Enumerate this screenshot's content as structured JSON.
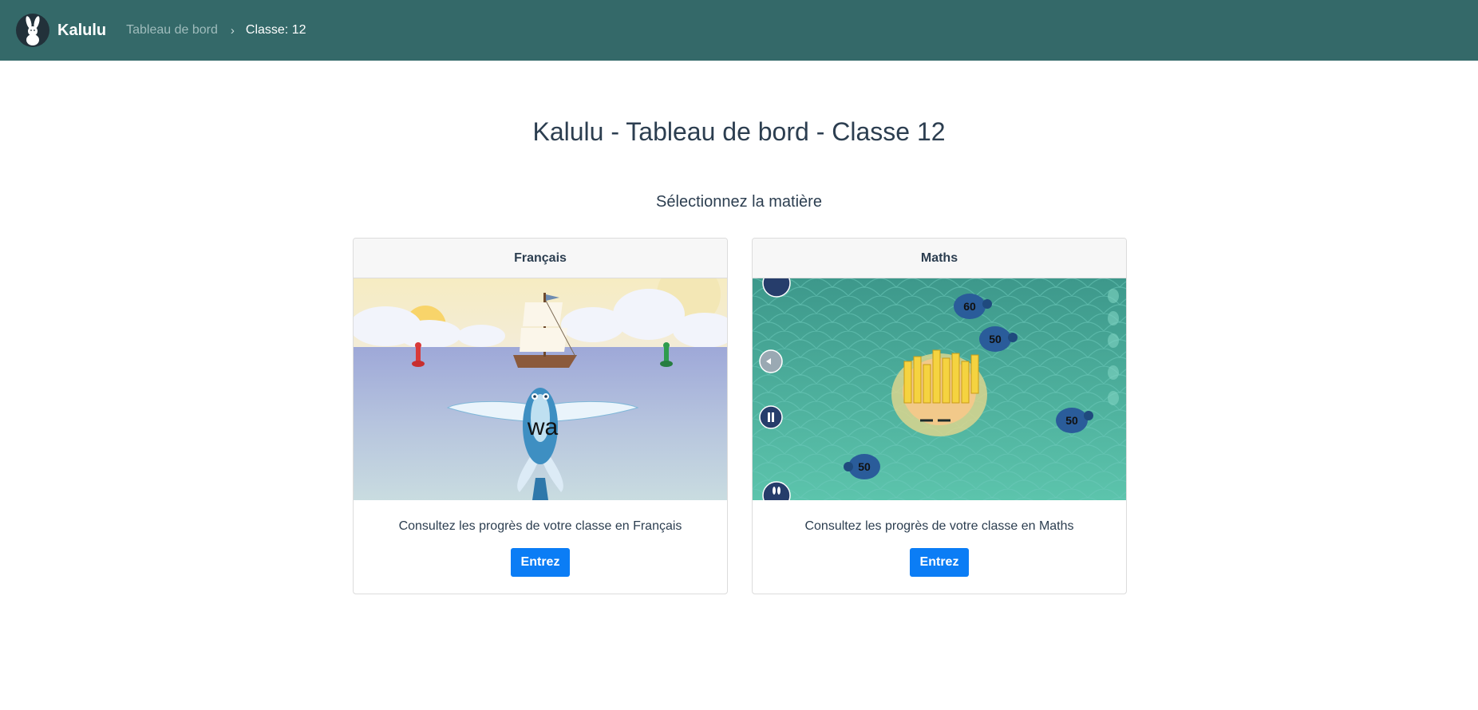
{
  "navbar": {
    "brand": "Kalulu",
    "logo_icon": "rabbit-logo-icon",
    "breadcrumb": {
      "dashboard": "Tableau de bord",
      "separator": "›",
      "current": "Classe: 12"
    }
  },
  "main": {
    "title": "Kalulu - Tableau de bord - Classe 12",
    "subtitle": "Sélectionnez la matière",
    "cards": [
      {
        "header": "Français",
        "image_label": "wa",
        "text": "Consultez les progrès de votre classe en Français",
        "button": "Entrez"
      },
      {
        "header": "Maths",
        "turtle_numbers": [
          "60",
          "50",
          "50",
          "50"
        ],
        "text": "Consultez les progrès de votre classe en Maths",
        "button": "Entrez"
      }
    ]
  },
  "colors": {
    "navbar": "#346969",
    "button": "#0b7df5",
    "text": "#2c3e50"
  }
}
